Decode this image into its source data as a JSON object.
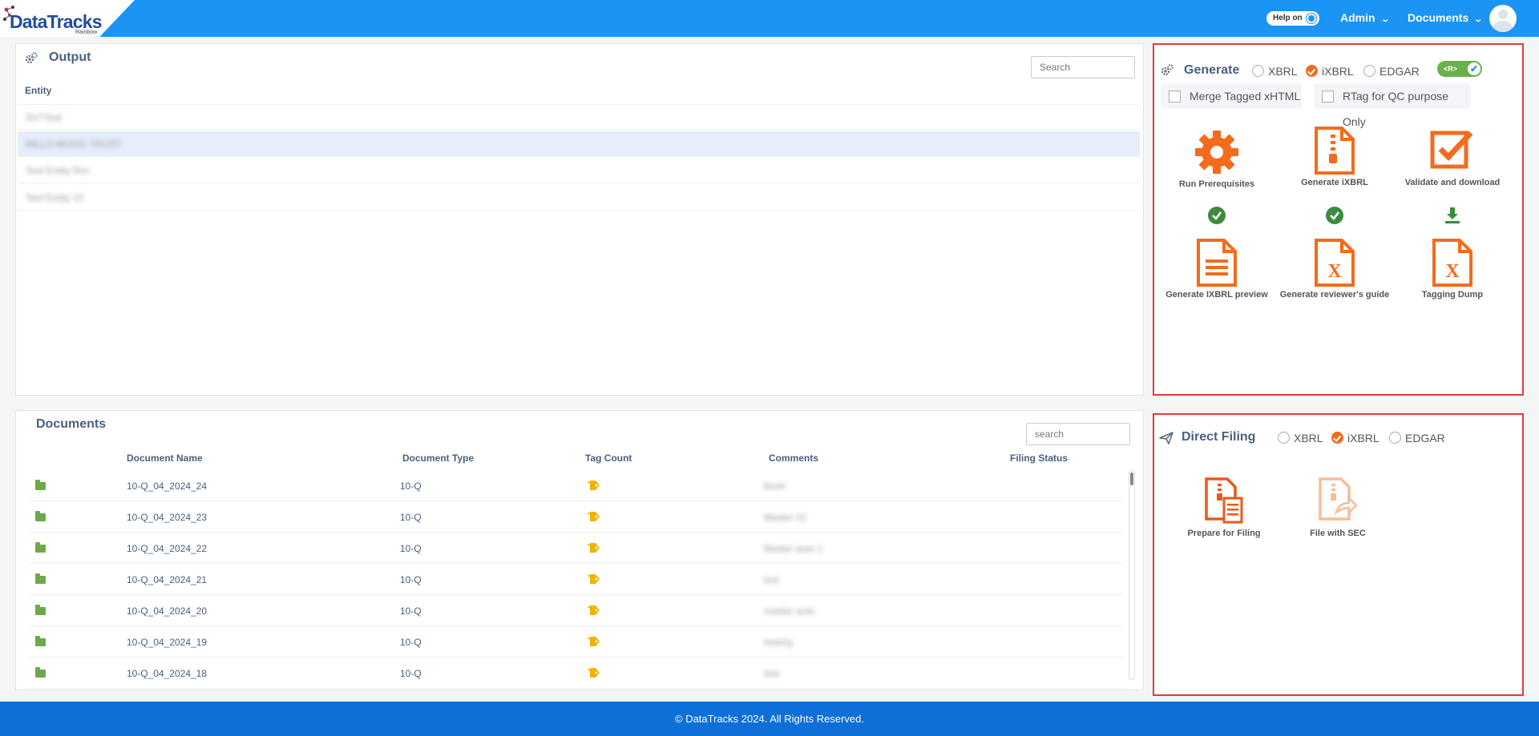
{
  "header": {
    "brand": "DataTracks",
    "brand_sub": "Rainbow",
    "help_label": "Help on",
    "nav": [
      {
        "label": "Admin"
      },
      {
        "label": "Documents"
      }
    ]
  },
  "output": {
    "title": "Output",
    "search_placeholder": "Search",
    "column": "Entity",
    "rows": [
      {
        "name": "SV7Test"
      },
      {
        "name": "MILLS MUSIC TRUST",
        "selected": true
      },
      {
        "name": "Test Entity Rev"
      },
      {
        "name": "Test Entity 10"
      }
    ]
  },
  "documents": {
    "title": "Documents",
    "search_placeholder": "search",
    "columns": [
      "Document Name",
      "Document Type",
      "Tag Count",
      "Comments",
      "Filing Status"
    ],
    "rows": [
      {
        "name": "10-Q_04_2024_24",
        "type": "10-Q",
        "comment": "fresh"
      },
      {
        "name": "10-Q_04_2024_23",
        "type": "10-Q",
        "comment": "Master 21"
      },
      {
        "name": "10-Q_04_2024_22",
        "type": "10-Q",
        "comment": "Master auto 1"
      },
      {
        "name": "10-Q_04_2024_21",
        "type": "10-Q",
        "comment": "test"
      },
      {
        "name": "10-Q_04_2024_20",
        "type": "10-Q",
        "comment": "master auto"
      },
      {
        "name": "10-Q_04_2024_19",
        "type": "10-Q",
        "comment": "testing"
      },
      {
        "name": "10-Q_04_2024_18",
        "type": "10-Q",
        "comment": "test"
      }
    ]
  },
  "generate": {
    "title": "Generate",
    "options": [
      "XBRL",
      "iXBRL",
      "EDGAR"
    ],
    "selected": "iXBRL",
    "toggle_label": "<R>",
    "merge_label": "Merge Tagged xHTML",
    "rtag_label": "RTag for QC purpose Only",
    "tiles": [
      {
        "label": "Run Prerequisites",
        "icon": "gear-icon",
        "status": "check-icon"
      },
      {
        "label": "Generate iXBRL",
        "icon": "zip-file-icon",
        "status": "check-icon"
      },
      {
        "label": "Validate and download",
        "icon": "checkbox-icon",
        "status": "download-icon"
      },
      {
        "label": "Generate IXBRL preview",
        "icon": "document-icon"
      },
      {
        "label": "Generate reviewer's guide",
        "icon": "excel-file-icon"
      },
      {
        "label": "Tagging Dump",
        "icon": "excel-file-icon"
      }
    ]
  },
  "direct_filing": {
    "title": "Direct Filing",
    "options": [
      "XBRL",
      "iXBRL",
      "EDGAR"
    ],
    "selected": "iXBRL",
    "tiles": [
      {
        "label": "Prepare for Filing",
        "icon": "prepare-filing-icon"
      },
      {
        "label": "File with SEC",
        "icon": "file-share-icon"
      }
    ]
  },
  "footer": {
    "text": "© DataTracks 2024. All Rights Reserved."
  },
  "colors": {
    "primary": "#1a94f5",
    "accent": "#f36b1c",
    "success": "#3d8b3d",
    "footer": "#0e6fd8"
  }
}
